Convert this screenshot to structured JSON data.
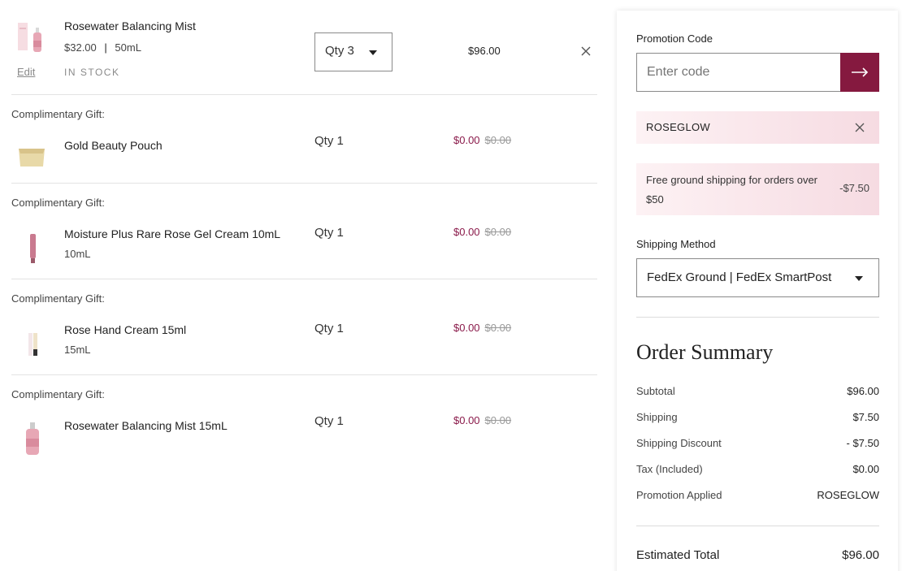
{
  "cart": {
    "main_item": {
      "name": "Rosewater Balancing Mist",
      "price": "$32.00",
      "size": "50mL",
      "edit_label": "Edit",
      "stock_label": "IN STOCK",
      "qty_label": "Qty 3",
      "line_total": "$96.00"
    },
    "gifts": [
      {
        "label": "Complimentary Gift:",
        "name": "Gold Beauty Pouch",
        "size": "",
        "qty": "Qty 1",
        "price": "$0.00",
        "was": "$0.00"
      },
      {
        "label": "Complimentary Gift:",
        "name": "Moisture Plus Rare Rose Gel Cream 10mL",
        "size": "10mL",
        "qty": "Qty 1",
        "price": "$0.00",
        "was": "$0.00"
      },
      {
        "label": "Complimentary Gift:",
        "name": "Rose Hand Cream 15ml",
        "size": "15mL",
        "qty": "Qty 1",
        "price": "$0.00",
        "was": "$0.00"
      },
      {
        "label": "Complimentary Gift:",
        "name": "Rosewater Balancing Mist 15mL",
        "size": "",
        "qty": "Qty 1",
        "price": "$0.00",
        "was": "$0.00"
      }
    ]
  },
  "panel": {
    "promo_label": "Promotion Code",
    "promo_placeholder": "Enter code",
    "applied_code": "ROSEGLOW",
    "shipping_promo_text": "Free ground shipping for orders over $50",
    "shipping_promo_amount": "-$7.50",
    "shipping_method_label": "Shipping Method",
    "shipping_method_value": "FedEx Ground | FedEx SmartPost",
    "summary_title": "Order Summary",
    "summary": {
      "subtotal_label": "Subtotal",
      "subtotal": "$96.00",
      "shipping_label": "Shipping",
      "shipping": "$7.50",
      "shipping_discount_label": "Shipping Discount",
      "shipping_discount": "- $7.50",
      "tax_label": "Tax (Included)",
      "tax": "$0.00",
      "promo_applied_label": "Promotion Applied",
      "promo_applied": "ROSEGLOW"
    },
    "estimated_total_label": "Estimated Total",
    "estimated_total": "$96.00"
  },
  "colors": {
    "accent": "#85193f",
    "price_red": "#8a1a4a",
    "pink_start": "#fdf2f4",
    "pink_end": "#f6dbe2"
  }
}
